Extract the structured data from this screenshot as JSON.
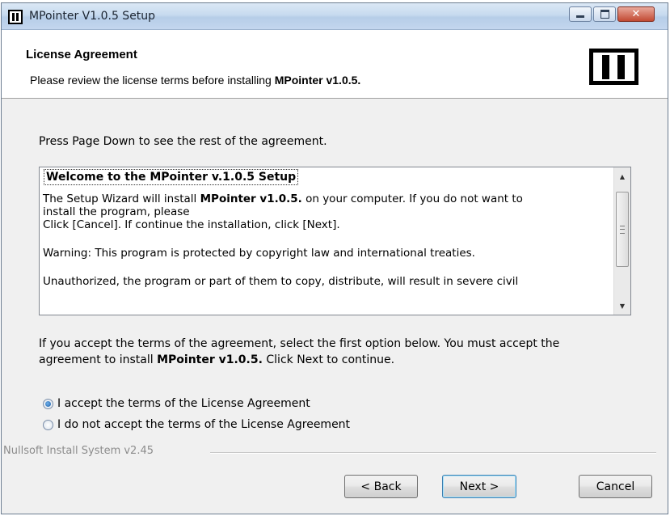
{
  "window": {
    "title": "MPointer V1.0.5 Setup",
    "buttons": [
      "minimize",
      "maximize",
      "close"
    ]
  },
  "header": {
    "title": "License Agreement",
    "subtitle_prefix": "Please review the license terms before installing",
    "subtitle_product": "MPointer v1.0.5."
  },
  "instructions": "Press Page Down to see the rest of the agreement.",
  "license": {
    "title": "Welcome to the MPointer v.1.0.5 Setup",
    "line1_prefix": "The Setup Wizard will install ",
    "line1_product": "MPointer v1.0.5.",
    "line1_suffix": "  on your computer. If you do not want to",
    "line2": "install the program, please",
    "line3": "Click [Cancel]. If continue the installation, click [Next].",
    "line4": "Warning: This program is protected by copyright law and international treaties.",
    "line5": "Unauthorized, the program or part of them to copy, distribute, will result in severe civil"
  },
  "accept": {
    "line1": "If you accept the terms of the agreement, select the first option below. You must accept the",
    "line2_prefix": "agreement to install ",
    "line2_product": "MPointer v1.0.5.",
    "line2_suffix": " Click Next to continue."
  },
  "options": {
    "accept_label": "I accept the terms of the License Agreement",
    "decline_label": "I do not accept the terms of the License Agreement",
    "selected": "accept"
  },
  "footer": {
    "branding": "Nullsoft Install System v2.45",
    "back_label": "< Back",
    "next_label": "Next >",
    "cancel_label": "Cancel"
  }
}
